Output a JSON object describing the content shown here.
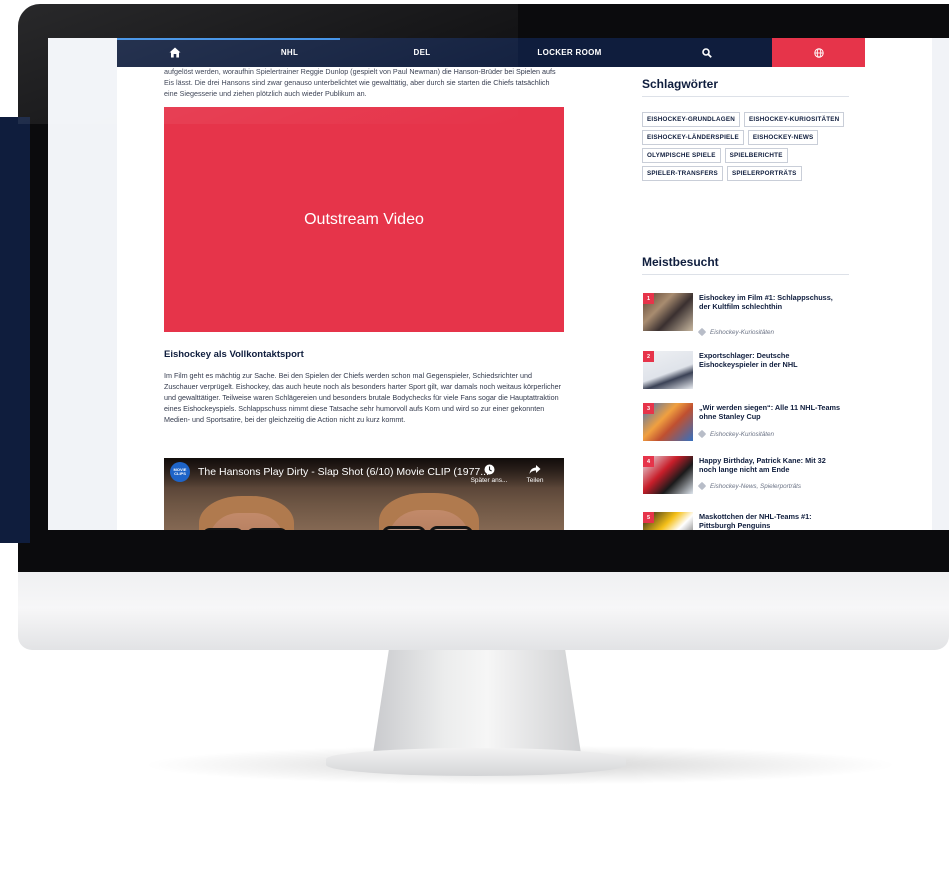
{
  "nav": {
    "items": [
      "NHL",
      "DEL",
      "LOCKER ROOM"
    ],
    "home_icon": "home-icon",
    "search_icon": "search-icon",
    "globe_icon": "globe-icon"
  },
  "article": {
    "intro": "aufgelöst werden, woraufhin Spielertrainer Reggie Dunlop (gespielt von Paul Newman) die Hanson-Brüder bei Spielen aufs Eis lässt. Die drei Hansons sind zwar genauso unterbelichtet wie gewalttätig, aber durch sie starten die Chiefs tatsächlich eine Siegesserie und ziehen plötzlich auch wieder Publikum an.",
    "ad_label": "Outstream Video",
    "heading": "Eishockey als Vollkontaktsport",
    "body": "Im Film geht es mächtig zur Sache. Bei den Spielen der Chiefs werden schon mal Gegenspieler, Schiedsrichter und Zuschauer verprügelt. Eishockey, das auch heute noch als besonders harter Sport gilt, war damals noch weitaus körperlicher und gewalttätiger. Teilweise waren Schlägereien und besonders brutale Bodychecks für viele Fans sogar die Hauptattraktion eines Eishockeyspiels. Schlappschuss nimmt diese Tatsache sehr humorvoll aufs Korn und wird so zur einer gekonnten Medien- und Sportsatire, bei der gleichzeitig die Action nicht zu kurz kommt."
  },
  "video": {
    "channel_logo": "MOVIE CLIPS",
    "title": "The Hansons Play Dirty - Slap Shot (6/10) Movie CLIP (1977...",
    "watch_later": "Später ans...",
    "share": "Teilen"
  },
  "sidebar": {
    "tags_title": "Schlagwörter",
    "tags": [
      "EISHOCKEY-GRUNDLAGEN",
      "EISHOCKEY-KURIOSITÄTEN",
      "EISHOCKEY-LÄNDERSPIELE",
      "EISHOCKEY-NEWS",
      "OLYMPISCHE SPIELE",
      "SPIELBERICHTE",
      "SPIELER-TRANSFERS",
      "SPIELERPORTRÄTS"
    ],
    "most_title": "Meistbesucht",
    "most": [
      {
        "rank": "1",
        "title": "Eishockey im Film #1: Schlappschuss, der Kultfilm schlechthin",
        "category": "Eishockey-Kuriositäten"
      },
      {
        "rank": "2",
        "title": "Exportschlager: Deutsche Eishockeyspieler in der NHL",
        "category": ""
      },
      {
        "rank": "3",
        "title": "„Wir werden siegen“: Alle 11 NHL-Teams ohne Stanley Cup",
        "category": "Eishockey-Kuriositäten"
      },
      {
        "rank": "4",
        "title": "Happy Birthday, Patrick Kane: Mit 32 noch lange nicht am Ende",
        "category": "Eishockey-News, Spielerporträts"
      },
      {
        "rank": "5",
        "title": "Maskottchen der NHL-Teams #1: Pittsburgh Penguins",
        "category": ""
      }
    ]
  },
  "colors": {
    "navy": "#0f1d3d",
    "accent_red": "#e6344a"
  }
}
